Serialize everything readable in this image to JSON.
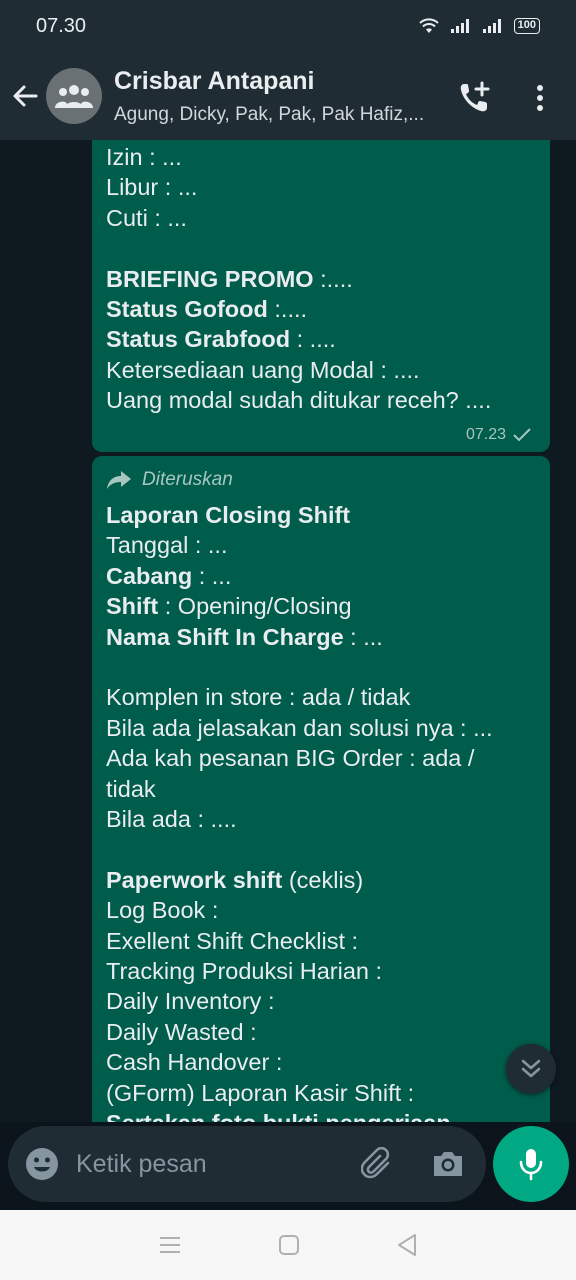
{
  "status_bar": {
    "time": "07.30",
    "battery": "100"
  },
  "header": {
    "title": "Crisbar Antapani",
    "subtitle": "Agung, Dicky, Pak, Pak, Pak Hafiz,..."
  },
  "messages": [
    {
      "lines": [
        {
          "text": "Izin : ..."
        },
        {
          "text": "Libur : ..."
        },
        {
          "text": "Cuti : ..."
        },
        {
          "text": ""
        },
        {
          "bold": "BRIEFING PROMO",
          "text": " :...."
        },
        {
          "bold": "Status Gofood",
          "text": " :...."
        },
        {
          "bold": "Status Grabfood",
          "text": " : ...."
        },
        {
          "text": "Ketersediaan uang Modal : ...."
        },
        {
          "text": "Uang modal sudah ditukar receh? ...."
        }
      ],
      "time": "07.23",
      "status_icon": "check-icon"
    },
    {
      "forwarded_label": "Diteruskan",
      "lines": [
        {
          "bold": "Laporan Closing Shift",
          "text": ""
        },
        {
          "text": "Tanggal : ..."
        },
        {
          "bold": "Cabang",
          "text": " :  ..."
        },
        {
          "bold": "Shift",
          "text": " : Opening/Closing"
        },
        {
          "bold": "Nama Shift In Charge",
          "text": " : ..."
        },
        {
          "text": ""
        },
        {
          "text": "Komplen in store : ada / tidak"
        },
        {
          "text": "Bila ada jelasakan dan solusi nya : ..."
        },
        {
          "text": "Ada kah pesanan BIG Order : ada /"
        },
        {
          "text": "tidak"
        },
        {
          "text": "Bila ada  : ...."
        },
        {
          "text": ""
        },
        {
          "bold": "Paperwork shift",
          "text": " (ceklis)"
        },
        {
          "text": "Log Book :"
        },
        {
          "text": "Exellent Shift Checklist :"
        },
        {
          "text": "Tracking Produksi Harian :"
        },
        {
          "text": "Daily Inventory :"
        },
        {
          "text": "Daily Wasted :"
        },
        {
          "text": "Cash Handover :"
        },
        {
          "text": "(GForm) Laporan Kasir Shift :"
        },
        {
          "bold": "Sertakan foto bukti pengerjaan",
          "text": ""
        }
      ]
    }
  ],
  "composer": {
    "placeholder": "Ketik pesan"
  },
  "colors": {
    "bubble": "#005c4b",
    "header": "#1f2c34",
    "accent": "#00a884"
  },
  "icons": {
    "back": "arrow-left-icon",
    "avatar": "group-icon",
    "call": "add-call-icon",
    "menu": "more-vertical-icon",
    "forward": "forward-arrow-icon",
    "scroll": "double-chevron-down-icon",
    "emoji": "emoji-icon",
    "attach": "paperclip-icon",
    "camera": "camera-icon",
    "mic": "microphone-icon"
  }
}
